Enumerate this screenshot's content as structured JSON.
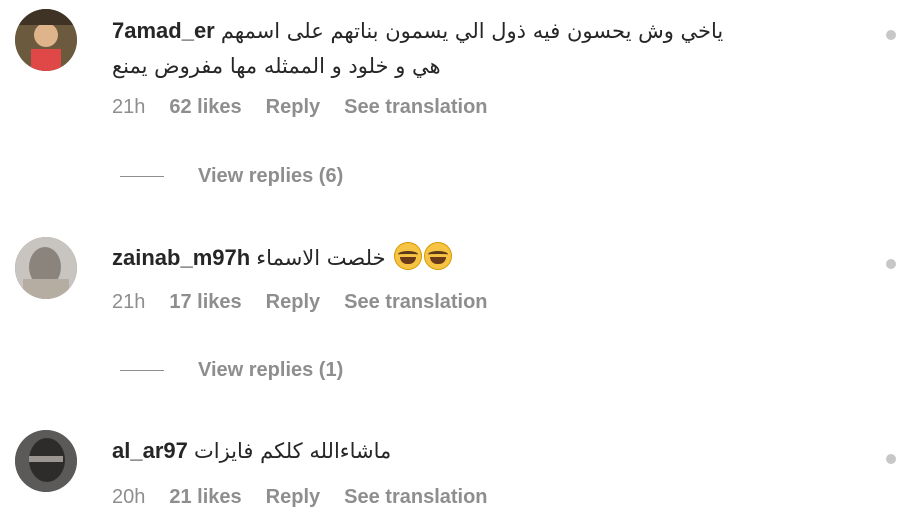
{
  "comments": [
    {
      "username": "7amad_er",
      "text_line1": "ياخي وش يحسون فيه ذول الي يسمون بناتهم على اسمهم",
      "text_line2": "هي و خلود و الممثله مها مفروض يمنع",
      "time": "21h",
      "likes": "62 likes",
      "reply": "Reply",
      "translation": "See translation",
      "view_replies": "View replies (6)"
    },
    {
      "username": "zainab_m97h",
      "text_line1": "خلصت الاسماء",
      "emoji": "😂😂",
      "time": "21h",
      "likes": "17 likes",
      "reply": "Reply",
      "translation": "See translation",
      "view_replies": "View replies (1)"
    },
    {
      "username": "al_ar97",
      "text_line1": "ماشاءالله كلكم فايزات",
      "time": "20h",
      "likes": "21 likes",
      "reply": "Reply",
      "translation": "See translation"
    }
  ]
}
